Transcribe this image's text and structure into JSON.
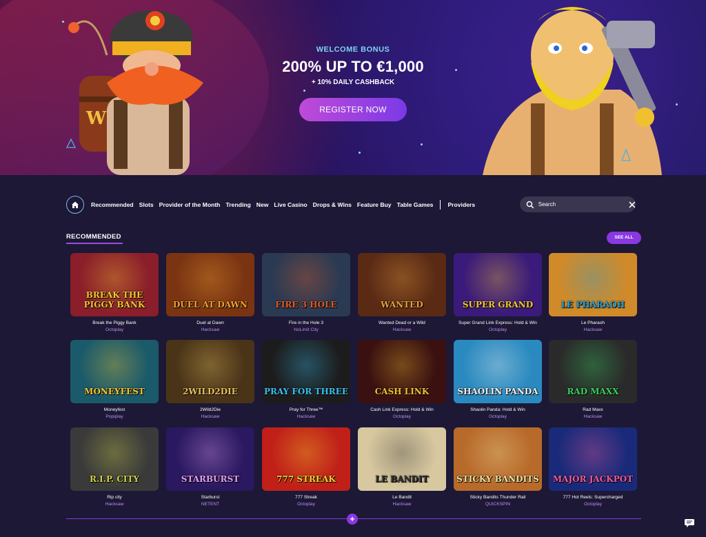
{
  "hero": {
    "welcome": "WELCOME BONUS",
    "headline": "200% UP TO €1,000",
    "cashback": "+ 10% DAILY CASHBACK",
    "cta": "REGISTER NOW"
  },
  "nav": {
    "items": [
      "Recommended",
      "Slots",
      "Provider of the Month",
      "Trending",
      "New",
      "Live Casino",
      "Drops & Wins",
      "Feature Buy",
      "Table Games"
    ],
    "providers": "Providers",
    "search_placeholder": "Search"
  },
  "section": {
    "title": "RECOMMENDED",
    "see_all": "SEE ALL"
  },
  "games": [
    {
      "name": "Break the Piggy Bank",
      "provider": "Octoplay",
      "art": "BREAK THE PIGGY BANK",
      "bg": "#8a1e2a",
      "accent": "#f5c531"
    },
    {
      "name": "Duel at Dawn",
      "provider": "Hacksaw",
      "art": "DUEL AT DAWN",
      "bg": "#7a3412",
      "accent": "#f0a030"
    },
    {
      "name": "Fire in the Hole 3",
      "provider": "NoLimit City",
      "art": "FIRE 3 HOLE",
      "bg": "#2a3a52",
      "accent": "#e05a28"
    },
    {
      "name": "Wanted Dead or a Wild",
      "provider": "Hacksaw",
      "art": "WANTED",
      "bg": "#5a2a14",
      "accent": "#e8a040"
    },
    {
      "name": "Super Grand Link Express: Hold & Win",
      "provider": "Octoplay",
      "art": "SUPER GRAND",
      "bg": "#3a1a7a",
      "accent": "#f5c531"
    },
    {
      "name": "Le Pharaoh",
      "provider": "Hacksaw",
      "art": "LE PHARAOH",
      "bg": "#d08a2a",
      "accent": "#2aa0d0"
    },
    {
      "name": "Moneyfest",
      "provider": "Popiplay",
      "art": "MONEYFEST",
      "bg": "#1a5a6a",
      "accent": "#f5c531"
    },
    {
      "name": "2Wild2Die",
      "provider": "Hacksaw",
      "art": "2WILD2DIE",
      "bg": "#4a3418",
      "accent": "#e8c060"
    },
    {
      "name": "Pray for Three™",
      "provider": "Hacksaw",
      "art": "PRAY FOR THREE",
      "bg": "#1c1c1c",
      "accent": "#3ac0f0"
    },
    {
      "name": "Cash Link Express: Hold & Win",
      "provider": "Octoplay",
      "art": "CASH LINK",
      "bg": "#3a1010",
      "accent": "#f0c030"
    },
    {
      "name": "Shaolin Panda: Hold & Win",
      "provider": "Octoplay",
      "art": "SHAOLIN PANDA",
      "bg": "#2a8ac0",
      "accent": "#f0f0f0"
    },
    {
      "name": "Rad Maxx",
      "provider": "Hacksaw",
      "art": "RAD MAXX",
      "bg": "#2a2a2a",
      "accent": "#3ad060"
    },
    {
      "name": "Rip city",
      "provider": "Hacksaw",
      "art": "R.I.P. CITY",
      "bg": "#3a3a3a",
      "accent": "#d0d04a"
    },
    {
      "name": "Starburst",
      "provider": "NETENT",
      "art": "STARBURST",
      "bg": "#2a1860",
      "accent": "#e0a0f0"
    },
    {
      "name": "777 Streak",
      "provider": "Octoplay",
      "art": "777 STREAK",
      "bg": "#c02018",
      "accent": "#f5d030"
    },
    {
      "name": "Le Bandit",
      "provider": "Hacksaw",
      "art": "LE BANDIT",
      "bg": "#d8c8a0",
      "accent": "#303030"
    },
    {
      "name": "Sticky Bandits Thunder Rail",
      "provider": "QUICKSPIN",
      "art": "STICKY BANDITS",
      "bg": "#b86a2a",
      "accent": "#f0e0a0"
    },
    {
      "name": "777 Hot Reels: Supercharged",
      "provider": "Octoplay",
      "art": "MAJOR JACKPOT",
      "bg": "#1a2a7a",
      "accent": "#f05a9a"
    }
  ],
  "colors": {
    "background": "#1c1836",
    "accent": "#8a38e0",
    "provider_text": "#c18ef0"
  }
}
